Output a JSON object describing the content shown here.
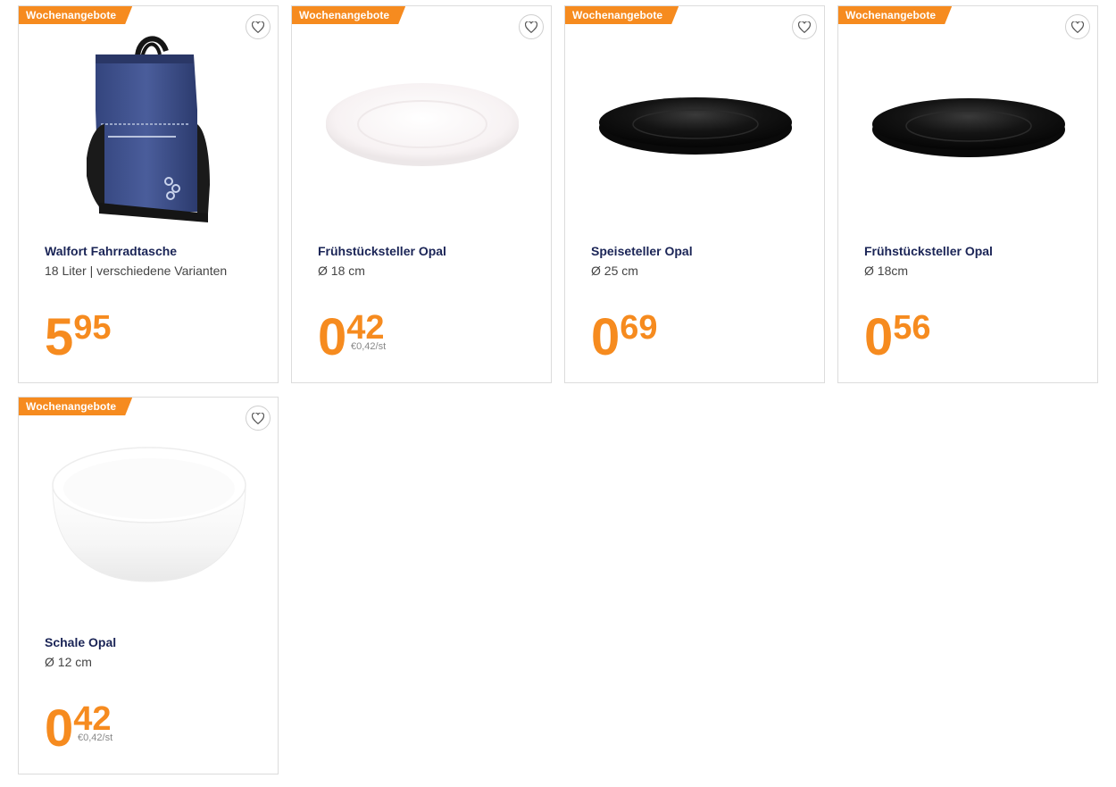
{
  "products": [
    {
      "badge": "Wochenangebote",
      "title": "Walfort Fahrradtasche",
      "subtitle": "18 Liter | verschiedene Varianten",
      "price_int": "5",
      "price_dec": "95",
      "unit_price": "",
      "image": "blue-bicycle-bag"
    },
    {
      "badge": "Wochenangebote",
      "title": "Frühstücksteller Opal",
      "subtitle": "Ø 18 cm",
      "price_int": "0",
      "price_dec": "42",
      "unit_price": "€0,42/st",
      "image": "white-plate"
    },
    {
      "badge": "Wochenangebote",
      "title": "Speiseteller Opal",
      "subtitle": "Ø 25 cm",
      "price_int": "0",
      "price_dec": "69",
      "unit_price": "",
      "image": "black-plate"
    },
    {
      "badge": "Wochenangebote",
      "title": "Frühstücksteller Opal",
      "subtitle": "Ø 18cm",
      "price_int": "0",
      "price_dec": "56",
      "unit_price": "",
      "image": "black-plate"
    },
    {
      "badge": "Wochenangebote",
      "title": "Schale Opal",
      "subtitle": "Ø 12 cm",
      "price_int": "0",
      "price_dec": "42",
      "unit_price": "€0,42/st",
      "image": "white-bowl"
    }
  ],
  "colors": {
    "accent": "#f68b1f",
    "title": "#1a2456",
    "border": "#dcdcdc"
  }
}
